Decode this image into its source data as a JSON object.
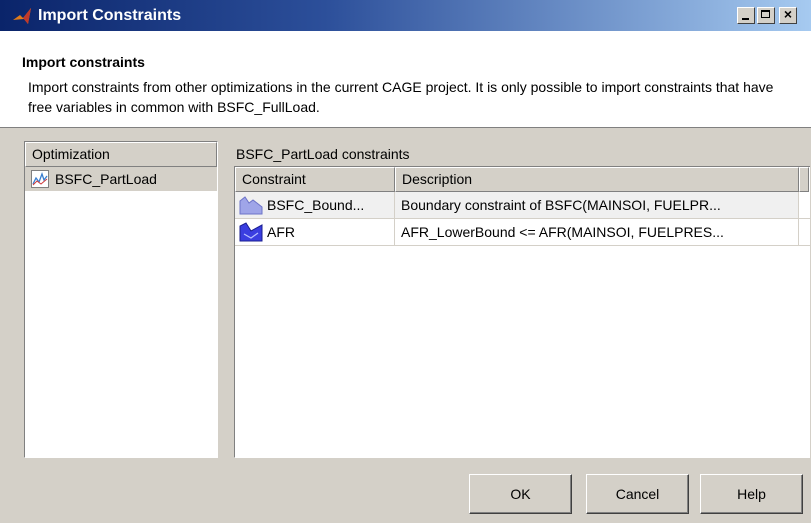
{
  "window": {
    "title": "Import Constraints",
    "caption_buttons": [
      "minimize-icon",
      "maximize-icon",
      "close-icon"
    ]
  },
  "header": {
    "title": "Import constraints",
    "description": "Import constraints from other optimizations in the current CAGE project. It is only possible to import constraints that have free variables in common with BSFC_FullLoad."
  },
  "optimizations": {
    "column_header": "Optimization",
    "items": [
      {
        "label": "BSFC_PartLoad",
        "icon": "optimization-icon"
      }
    ]
  },
  "constraints": {
    "title": "BSFC_PartLoad constraints",
    "columns": [
      "Constraint",
      "Description"
    ],
    "rows": [
      {
        "name": "BSFC_Bound...",
        "description": "Boundary constraint of BSFC(MAINSOI, FUELPR...",
        "icon": "boundary-constraint-icon",
        "icon_color": "#9fa5e8"
      },
      {
        "name": "AFR",
        "description": "AFR_LowerBound <= AFR(MAINSOI, FUELPRES...",
        "icon": "afr-constraint-icon",
        "icon_color": "#3a3ee0"
      }
    ]
  },
  "buttons": {
    "ok": "OK",
    "cancel": "Cancel",
    "help": "Help"
  }
}
